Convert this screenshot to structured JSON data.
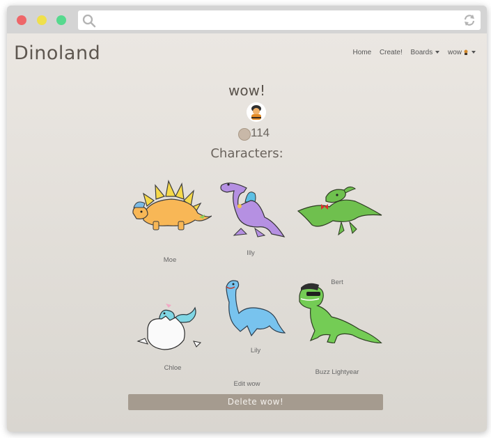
{
  "site": {
    "brand": "Dinoland"
  },
  "nav": {
    "items": [
      "Home",
      "Create!",
      "Boards",
      "wow"
    ]
  },
  "board": {
    "title": "wow!",
    "coins": "114"
  },
  "characters_heading": "Characters:",
  "characters": [
    {
      "name": "Moe",
      "color": "#f8c15b"
    },
    {
      "name": "Illy",
      "color": "#b68fe0"
    },
    {
      "name": "Bert",
      "color": "#6cbf4d"
    },
    {
      "name": "Chloe",
      "color": "#7fd6e6"
    },
    {
      "name": "Lily",
      "color": "#7ac8ee"
    },
    {
      "name": "Buzz Lightyear",
      "color": "#6fcf52"
    }
  ],
  "actions": {
    "edit": "Edit wow",
    "delete": "Delete wow!"
  }
}
